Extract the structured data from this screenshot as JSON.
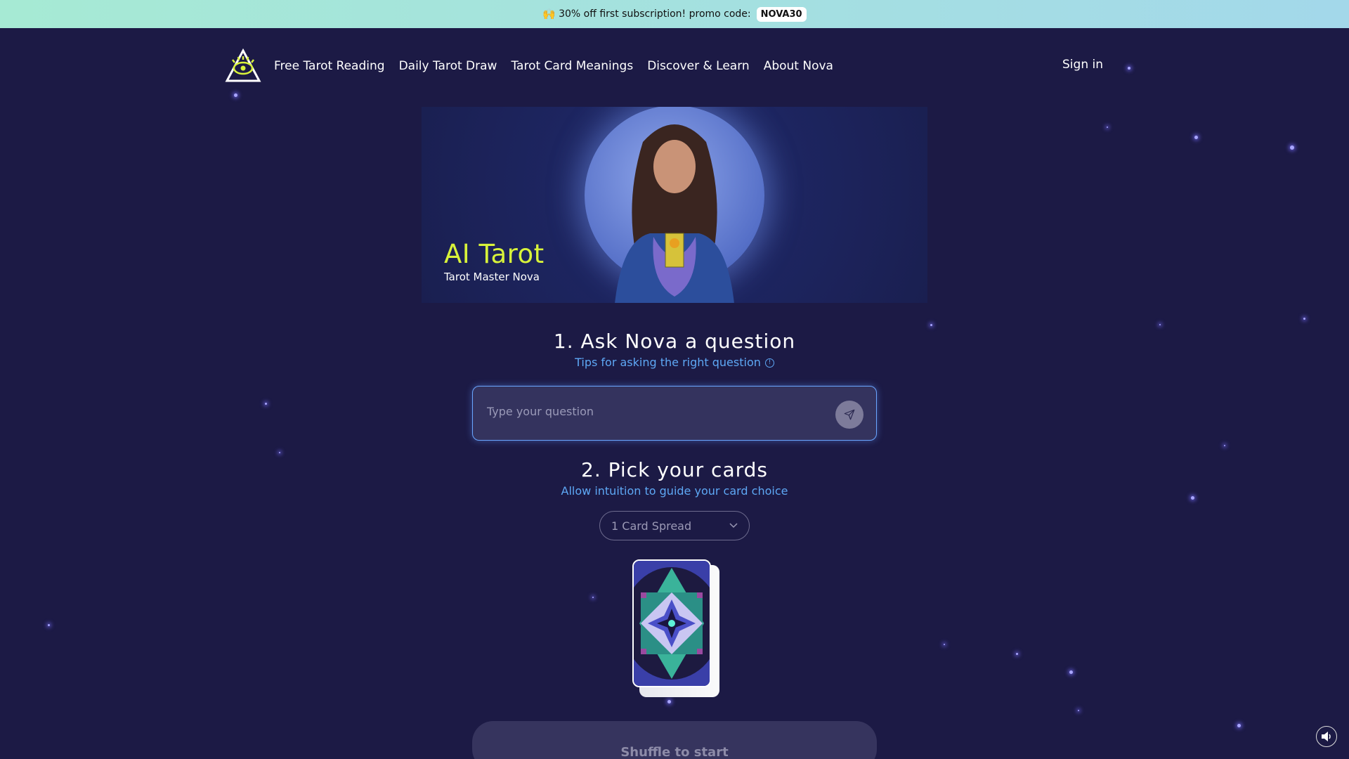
{
  "promo": {
    "emoji": "🙌",
    "text": "30% off first subscription! promo code:",
    "code": "NOVA30"
  },
  "nav": {
    "items": [
      "Free Tarot Reading",
      "Daily Tarot Draw",
      "Tarot Card Meanings",
      "Discover & Learn",
      "About Nova"
    ],
    "sign_in": "Sign in"
  },
  "banner": {
    "title": "AI Tarot",
    "subtitle": "Tarot Master Nova"
  },
  "step1": {
    "title": "1. Ask Nova a question",
    "tips": "Tips for asking the right question",
    "placeholder": "Type your question",
    "value": ""
  },
  "step2": {
    "title": "2. Pick your cards",
    "subtitle": "Allow intuition to guide your card choice",
    "spread": "1 Card Spread"
  },
  "shuffle_label": "Shuffle to start",
  "colors": {
    "background": "#1c1a45",
    "accent_title": "#d8f23a",
    "link": "#5ea8f5",
    "input_border": "#6aa6ff"
  }
}
